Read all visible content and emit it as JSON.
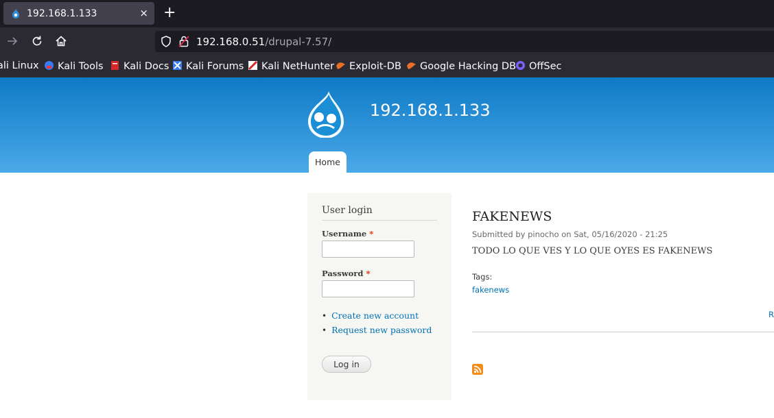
{
  "browser": {
    "tab": {
      "title": "192.168.1.133",
      "close_label": "×"
    },
    "new_tab_label": "+",
    "url": {
      "host": "192.168.0.51",
      "path": "/drupal-7.57/"
    },
    "bookmarks": [
      {
        "label": "ali Linux",
        "icon": "kali-icon"
      },
      {
        "label": "Kali Tools",
        "icon": "kali-tools-icon"
      },
      {
        "label": "Kali Docs",
        "icon": "kali-docs-icon"
      },
      {
        "label": "Kali Forums",
        "icon": "kali-forums-icon"
      },
      {
        "label": "Kali NetHunter",
        "icon": "kali-nethunter-icon"
      },
      {
        "label": "Exploit-DB",
        "icon": "exploit-db-icon"
      },
      {
        "label": "Google Hacking DB",
        "icon": "google-hacking-db-icon"
      },
      {
        "label": "OffSec",
        "icon": "offsec-icon"
      }
    ]
  },
  "site": {
    "name": "192.168.1.133",
    "nav": {
      "home": "Home"
    }
  },
  "login_block": {
    "title": "User login",
    "username_label": "Username",
    "password_label": "Password",
    "required_mark": "*",
    "links": [
      "Create new account",
      "Request new password"
    ],
    "submit_label": "Log in"
  },
  "article": {
    "title": "FAKENEWS",
    "submitted": "Submitted by pinocho on Sat, 05/16/2020 - 21:25",
    "body": "TODO LO QUE VES Y LO QUE OYES ES FAKENEWS",
    "tags_label": "Tags:",
    "tag": "fakenews",
    "read_more": "R"
  },
  "colors": {
    "header_top": "#0f7ac6",
    "header_bottom": "#4aa9e8",
    "link": "#0071b3",
    "feed": "#f38c18"
  }
}
